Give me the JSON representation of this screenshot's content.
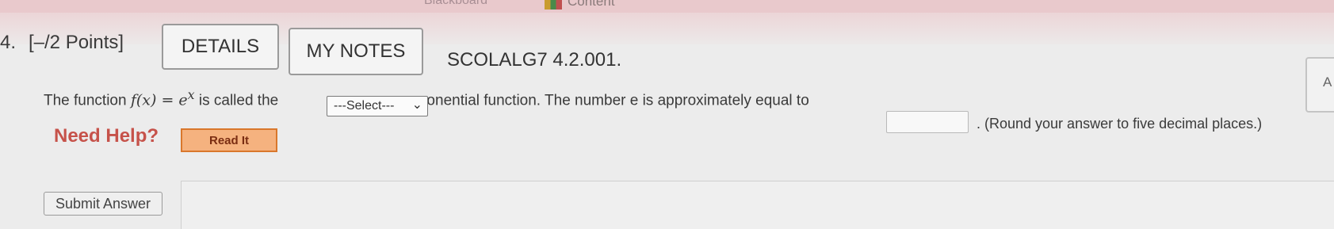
{
  "browser_bar": {
    "bookmark_partial": "Blackboard",
    "bookmark_content": "Content"
  },
  "question": {
    "number": "4.",
    "points": "[–/2 Points]",
    "details_label": "DETAILS",
    "my_notes_label": "MY NOTES",
    "code": "SCOLALG7 4.2.001.",
    "side_tab_label": "A",
    "text_before_func": "The function ",
    "func": "f(x) = e",
    "func_exp": "x",
    "text_after_func": " is called the",
    "select_value": "---Select---",
    "text_middle": "exponential function. The number e is approximately equal to",
    "round_note": ". (Round your answer to five decimal places.)",
    "answer_value": "",
    "need_help": "Need Help?",
    "read_it_label": "Read It",
    "submit_label": "Submit Answer"
  },
  "colors": {
    "need_help": "#c6524a",
    "read_it_bg": "#f5b27f",
    "read_it_border": "#d9772c"
  }
}
